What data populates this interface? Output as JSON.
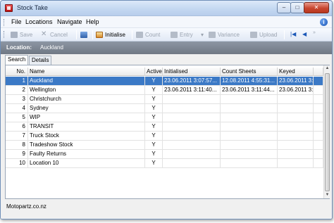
{
  "window": {
    "title": "Stock Take",
    "buttons": {
      "minimize": "–",
      "maximize": "□",
      "close": "✕"
    }
  },
  "menu": {
    "items": [
      "File",
      "Locations",
      "Navigate",
      "Help"
    ],
    "help_icon": "i"
  },
  "toolbar": {
    "save": "Save",
    "cancel": "Cancel",
    "initialise": "Initialise",
    "count": "Count",
    "entry": "Entry",
    "variance": "Variance",
    "upload": "Upload",
    "nav_first": "|◀",
    "nav_prev": "◀"
  },
  "location": {
    "label": "Location:",
    "value": "Auckland"
  },
  "tabs": [
    "Search",
    "Details"
  ],
  "grid": {
    "columns": [
      "No.",
      "Name",
      "Active",
      "Initialised",
      "Count Sheets",
      "Keyed",
      ""
    ],
    "rows": [
      {
        "no": "1",
        "name": "Auckland",
        "active": "Y",
        "initialised": "23.06.2011 3:07:57...",
        "count_sheets": "12.08.2011 4:55:31...",
        "keyed": "23.06.2011 3:0",
        "selected": true
      },
      {
        "no": "2",
        "name": "Wellington",
        "active": "Y",
        "initialised": "23.06.2011 3:11:40...",
        "count_sheets": "23.06.2011 3:11:44...",
        "keyed": "23.06.2011 3:1",
        "selected": false
      },
      {
        "no": "3",
        "name": "Christchurch",
        "active": "Y",
        "initialised": "",
        "count_sheets": "",
        "keyed": "",
        "selected": false
      },
      {
        "no": "4",
        "name": "Sydney",
        "active": "Y",
        "initialised": "",
        "count_sheets": "",
        "keyed": "",
        "selected": false
      },
      {
        "no": "5",
        "name": "WIP",
        "active": "Y",
        "initialised": "",
        "count_sheets": "",
        "keyed": "",
        "selected": false
      },
      {
        "no": "6",
        "name": "TRANSIT",
        "active": "Y",
        "initialised": "",
        "count_sheets": "",
        "keyed": "",
        "selected": false
      },
      {
        "no": "7",
        "name": "Truck Stock",
        "active": "Y",
        "initialised": "",
        "count_sheets": "",
        "keyed": "",
        "selected": false
      },
      {
        "no": "8",
        "name": "Tradeshow Stock",
        "active": "Y",
        "initialised": "",
        "count_sheets": "",
        "keyed": "",
        "selected": false
      },
      {
        "no": "9",
        "name": "Faulty Returns",
        "active": "Y",
        "initialised": "",
        "count_sheets": "",
        "keyed": "",
        "selected": false
      },
      {
        "no": "10",
        "name": "Location 10",
        "active": "Y",
        "initialised": "",
        "count_sheets": "",
        "keyed": "",
        "selected": false
      }
    ]
  },
  "status": {
    "text": "Motopartz.co.nz"
  },
  "colors": {
    "selection": "#3b79c6",
    "location_bar": "#7a838f",
    "close_button": "#c8462f"
  }
}
